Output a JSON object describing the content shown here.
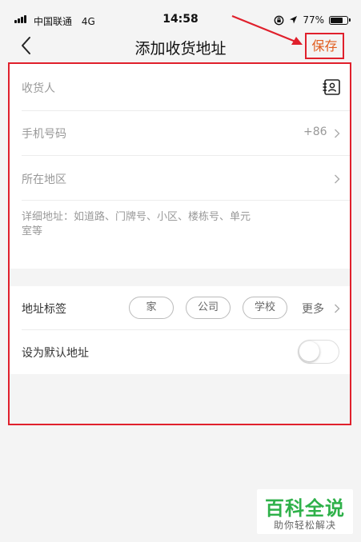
{
  "status_bar": {
    "carrier": "中国联通",
    "network": "4G",
    "time": "14:58",
    "battery_text": "77%",
    "battery_level": 0.77
  },
  "nav": {
    "title": "添加收货地址",
    "save_label": "保存"
  },
  "form": {
    "receiver_placeholder": "收货人",
    "phone_placeholder": "手机号码",
    "country_code": "+86",
    "region_placeholder": "所在地区",
    "address_placeholder": "详细地址：如道路、门牌号、小区、楼栋号、单元室等",
    "address_line1": "详细地址：如道路、门牌号、小区、楼栋号、单元",
    "address_line2": "室等"
  },
  "settings": {
    "tag_label": "地址标签",
    "tags": [
      "家",
      "公司",
      "学校"
    ],
    "more_label": "更多",
    "default_label": "设为默认地址",
    "default_enabled": false
  },
  "watermark": {
    "title": "百科全说",
    "subtitle": "助你轻松解决"
  },
  "colors": {
    "accent": "#e15c1e",
    "highlight_red": "#e0202c",
    "watermark_green": "#2fb14a"
  }
}
